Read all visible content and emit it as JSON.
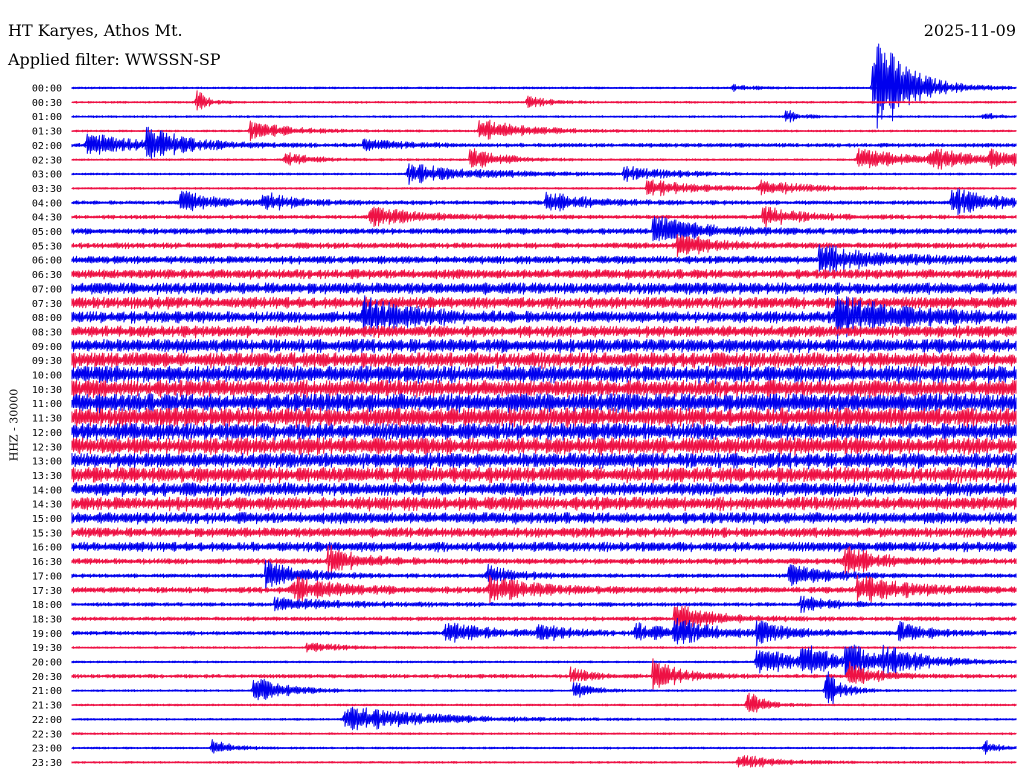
{
  "header": {
    "station": "HT Karyes, Athos Mt.",
    "date": "2025-11-09",
    "filter": "Applied filter: WWSSN-SP"
  },
  "chart_data": {
    "type": "line",
    "title": "HT Karyes, Athos Mt.",
    "subtitle": "Applied filter: WWSSN-SP",
    "date": "2025-11-09",
    "ylabel": "HHZ - 30000",
    "colors": {
      "even_rows": "#0000ee",
      "odd_rows": "#ee1144"
    },
    "row_labels": [
      "00:00",
      "00:30",
      "01:00",
      "01:30",
      "02:00",
      "02:30",
      "03:00",
      "03:30",
      "04:00",
      "04:30",
      "05:00",
      "05:30",
      "06:00",
      "06:30",
      "07:00",
      "07:30",
      "08:00",
      "08:30",
      "09:00",
      "09:30",
      "10:00",
      "10:30",
      "11:00",
      "11:30",
      "12:00",
      "12:30",
      "13:00",
      "13:30",
      "14:00",
      "14:30",
      "15:00",
      "15:30",
      "16:00",
      "16:30",
      "17:00",
      "17:30",
      "18:00",
      "18:30",
      "19:00",
      "19:30",
      "20:00",
      "20:30",
      "21:00",
      "21:30",
      "22:00",
      "22:30",
      "23:00",
      "23:30"
    ],
    "row_duration_minutes": 30,
    "noise_amplitude": [
      1,
      1,
      1,
      1,
      2,
      1,
      1,
      1,
      2,
      2,
      3,
      3,
      4,
      5,
      6,
      6,
      6,
      6,
      7,
      8,
      9,
      9,
      10,
      10,
      9,
      9,
      8,
      8,
      7,
      7,
      6,
      5,
      5,
      3,
      2,
      3,
      2,
      2,
      2,
      1,
      1,
      2,
      1,
      1,
      1,
      1,
      1,
      1
    ],
    "events": [
      {
        "row": 0,
        "minute": 25.5,
        "amplitude": 60,
        "duration_min": 1
      },
      {
        "row": 0,
        "minute": 21.0,
        "amplitude": 4,
        "duration_min": 0.5
      },
      {
        "row": 1,
        "minute": 14.5,
        "amplitude": 6,
        "duration_min": 0.7
      },
      {
        "row": 1,
        "minute": 4.0,
        "amplitude": 12,
        "duration_min": 0.3
      },
      {
        "row": 2,
        "minute": 22.7,
        "amplitude": 7,
        "duration_min": 0.4
      },
      {
        "row": 2,
        "minute": 29.0,
        "amplitude": 4,
        "duration_min": 0.4
      },
      {
        "row": 3,
        "minute": 5.7,
        "amplitude": 10,
        "duration_min": 1.2
      },
      {
        "row": 3,
        "minute": 13.0,
        "amplitude": 12,
        "duration_min": 1.5
      },
      {
        "row": 4,
        "minute": 0.5,
        "amplitude": 12,
        "duration_min": 1.5
      },
      {
        "row": 4,
        "minute": 2.4,
        "amplitude": 16,
        "duration_min": 1.2
      },
      {
        "row": 4,
        "minute": 9.3,
        "amplitude": 5,
        "duration_min": 1.2
      },
      {
        "row": 5,
        "minute": 6.8,
        "amplitude": 7,
        "duration_min": 1.0
      },
      {
        "row": 5,
        "minute": 12.7,
        "amplitude": 12,
        "duration_min": 1.0
      },
      {
        "row": 5,
        "minute": 25.0,
        "amplitude": 12,
        "duration_min": 1.5
      },
      {
        "row": 5,
        "minute": 27.3,
        "amplitude": 10,
        "duration_min": 1.5
      },
      {
        "row": 5,
        "minute": 29.2,
        "amplitude": 8,
        "duration_min": 0.8
      },
      {
        "row": 6,
        "minute": 10.7,
        "amplitude": 10,
        "duration_min": 2.5
      },
      {
        "row": 6,
        "minute": 17.6,
        "amplitude": 7,
        "duration_min": 1.5
      },
      {
        "row": 7,
        "minute": 18.3,
        "amplitude": 9,
        "duration_min": 1.5
      },
      {
        "row": 7,
        "minute": 21.9,
        "amplitude": 8,
        "duration_min": 1.5
      },
      {
        "row": 8,
        "minute": 3.5,
        "amplitude": 12,
        "duration_min": 1.0
      },
      {
        "row": 8,
        "minute": 6.1,
        "amplitude": 10,
        "duration_min": 1.0
      },
      {
        "row": 8,
        "minute": 15.1,
        "amplitude": 10,
        "duration_min": 1.5
      },
      {
        "row": 8,
        "minute": 28.0,
        "amplitude": 14,
        "duration_min": 1.5
      },
      {
        "row": 9,
        "minute": 9.5,
        "amplitude": 10,
        "duration_min": 1.5
      },
      {
        "row": 9,
        "minute": 22.0,
        "amplitude": 10,
        "duration_min": 1.2
      },
      {
        "row": 10,
        "minute": 18.5,
        "amplitude": 14,
        "duration_min": 1.5
      },
      {
        "row": 11,
        "minute": 19.3,
        "amplitude": 12,
        "duration_min": 1.0
      },
      {
        "row": 12,
        "minute": 23.8,
        "amplitude": 14,
        "duration_min": 1.5
      },
      {
        "row": 16,
        "minute": 9.3,
        "amplitude": 16,
        "duration_min": 1.5
      },
      {
        "row": 16,
        "minute": 24.3,
        "amplitude": 18,
        "duration_min": 2.0
      },
      {
        "row": 33,
        "minute": 8.2,
        "amplitude": 14,
        "duration_min": 1.0
      },
      {
        "row": 33,
        "minute": 24.6,
        "amplitude": 16,
        "duration_min": 1.0
      },
      {
        "row": 34,
        "minute": 6.2,
        "amplitude": 14,
        "duration_min": 1.2
      },
      {
        "row": 34,
        "minute": 13.2,
        "amplitude": 10,
        "duration_min": 1.0
      },
      {
        "row": 34,
        "minute": 22.8,
        "amplitude": 12,
        "duration_min": 1.2
      },
      {
        "row": 35,
        "minute": 7.0,
        "amplitude": 12,
        "duration_min": 1.5
      },
      {
        "row": 35,
        "minute": 13.3,
        "amplitude": 12,
        "duration_min": 1.5
      },
      {
        "row": 35,
        "minute": 25.0,
        "amplitude": 14,
        "duration_min": 1.5
      },
      {
        "row": 36,
        "minute": 6.5,
        "amplitude": 6,
        "duration_min": 2.0
      },
      {
        "row": 36,
        "minute": 23.2,
        "amplitude": 8,
        "duration_min": 1.0
      },
      {
        "row": 37,
        "minute": 19.2,
        "amplitude": 14,
        "duration_min": 1.2
      },
      {
        "row": 38,
        "minute": 11.9,
        "amplitude": 10,
        "duration_min": 1.5
      },
      {
        "row": 38,
        "minute": 14.8,
        "amplitude": 8,
        "duration_min": 1.0
      },
      {
        "row": 38,
        "minute": 17.9,
        "amplitude": 10,
        "duration_min": 1.0
      },
      {
        "row": 38,
        "minute": 19.2,
        "amplitude": 14,
        "duration_min": 1.2
      },
      {
        "row": 38,
        "minute": 21.8,
        "amplitude": 10,
        "duration_min": 1.2
      },
      {
        "row": 38,
        "minute": 26.3,
        "amplitude": 10,
        "duration_min": 1.0
      },
      {
        "row": 39,
        "minute": 7.5,
        "amplitude": 6,
        "duration_min": 1.0
      },
      {
        "row": 40,
        "minute": 21.8,
        "amplitude": 18,
        "duration_min": 1.0
      },
      {
        "row": 40,
        "minute": 23.2,
        "amplitude": 16,
        "duration_min": 1.2
      },
      {
        "row": 40,
        "minute": 24.6,
        "amplitude": 14,
        "duration_min": 1.5
      },
      {
        "row": 40,
        "minute": 25.8,
        "amplitude": 10,
        "duration_min": 1.2
      },
      {
        "row": 41,
        "minute": 18.5,
        "amplitude": 16,
        "duration_min": 0.8
      },
      {
        "row": 41,
        "minute": 15.9,
        "amplitude": 8,
        "duration_min": 0.6
      },
      {
        "row": 41,
        "minute": 24.7,
        "amplitude": 14,
        "duration_min": 0.8
      },
      {
        "row": 42,
        "minute": 5.8,
        "amplitude": 14,
        "duration_min": 1.0
      },
      {
        "row": 42,
        "minute": 16.0,
        "amplitude": 8,
        "duration_min": 0.6
      },
      {
        "row": 42,
        "minute": 24.0,
        "amplitude": 20,
        "duration_min": 0.5
      },
      {
        "row": 43,
        "minute": 21.5,
        "amplitude": 14,
        "duration_min": 0.5
      },
      {
        "row": 44,
        "minute": 8.7,
        "amplitude": 14,
        "duration_min": 2.5
      },
      {
        "row": 46,
        "minute": 4.5,
        "amplitude": 10,
        "duration_min": 0.5
      },
      {
        "row": 46,
        "minute": 29.0,
        "amplitude": 8,
        "duration_min": 0.4
      },
      {
        "row": 47,
        "minute": 21.2,
        "amplitude": 8,
        "duration_min": 1.2
      }
    ]
  }
}
